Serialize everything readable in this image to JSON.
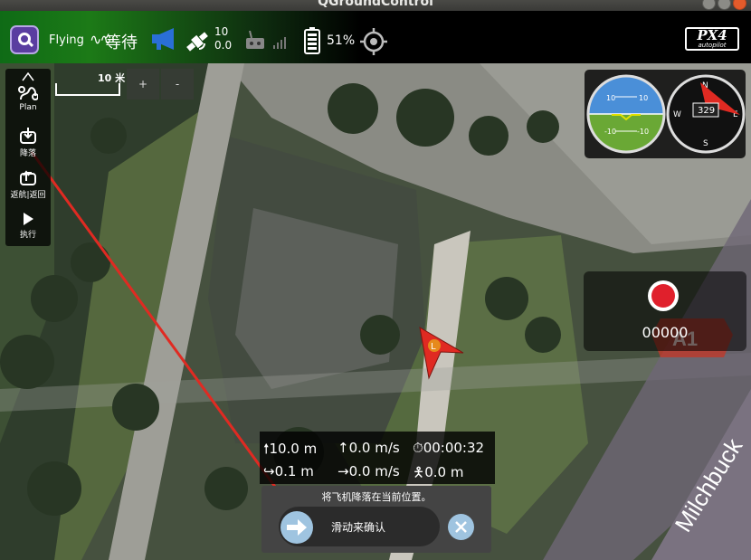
{
  "window": {
    "title": "QGroundControl"
  },
  "toolbar": {
    "flight_state": "Flying",
    "flight_mode": "等待",
    "gps": {
      "satellites": "10",
      "hdop": "0.0"
    },
    "battery_percent": "51%",
    "brand": {
      "line1": "PX4",
      "line2": "autopilot"
    }
  },
  "map": {
    "scale_label": "10 米",
    "zoom_in": "+",
    "zoom_out": "-",
    "road_label": "Milchbuck",
    "building_badge": "A1",
    "vehicle_marker": "L"
  },
  "toolstrip": {
    "items": [
      {
        "label": "Plan",
        "icon": "plan-route-icon"
      },
      {
        "label": "降落",
        "icon": "land-icon"
      },
      {
        "label": "返航|返回",
        "icon": "return-icon"
      },
      {
        "label": "执行",
        "icon": "play-icon"
      }
    ]
  },
  "instruments": {
    "attitude_ticks": [
      "10",
      "10",
      "-10",
      "-10"
    ],
    "compass": {
      "heading": "329",
      "n": "N",
      "e": "E",
      "s": "S",
      "w": "W"
    }
  },
  "video": {
    "record_time": "00000"
  },
  "telemetry": {
    "altitude": "10.0 m",
    "climb_rate": "0.0 m/s",
    "flight_time": "00:00:32",
    "distance_home": "0.1 m",
    "ground_speed": "0.0 m/s",
    "distance_gcs": "0.0 m"
  },
  "guided_confirm": {
    "message": "将飞机降落在当前位置。",
    "slider_text": "滑动来确认"
  },
  "colors": {
    "accent": "#9fc4e0",
    "record": "#e0202c",
    "toolbar_green": "#1c7a17",
    "arrow_red": "#e02a22"
  }
}
